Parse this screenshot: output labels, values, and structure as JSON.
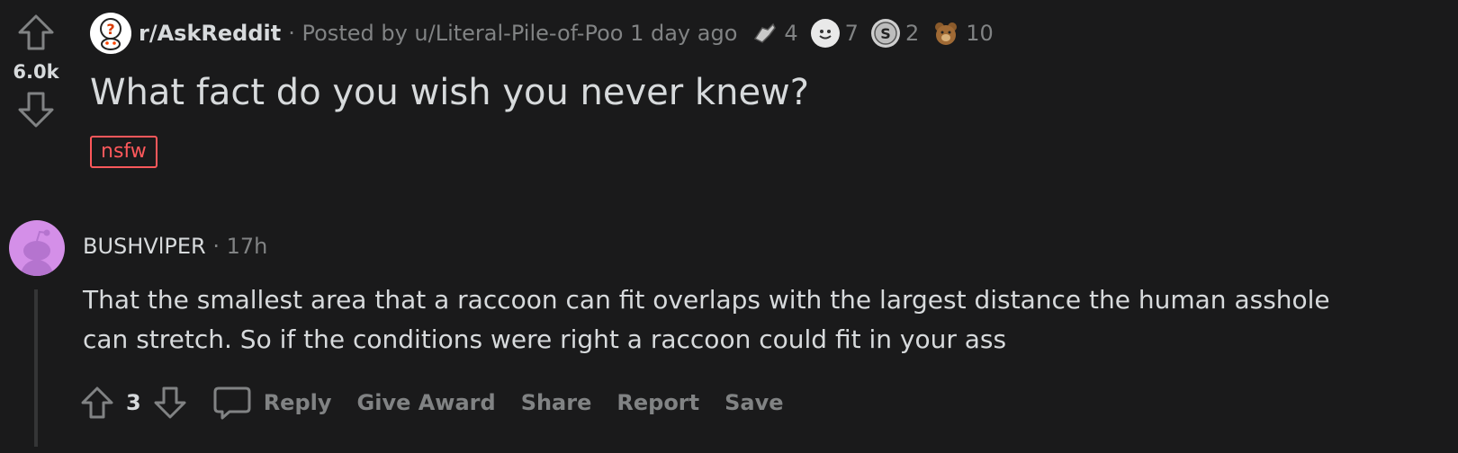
{
  "post": {
    "score": "6.0k",
    "subreddit": "r/AskReddit",
    "meta": "· Posted by u/Literal-Pile-of-Poo 1 day ago",
    "awards": [
      {
        "icon": "helpful-award-icon",
        "count": "4"
      },
      {
        "icon": "wholesome-award-icon",
        "count": "7"
      },
      {
        "icon": "silver-award-icon",
        "count": "2"
      },
      {
        "icon": "bear-award-icon",
        "count": "10"
      }
    ],
    "title": "What fact do you wish you never knew?",
    "flair": "nsfw"
  },
  "comment": {
    "author": "BUSHVlPER",
    "meta": "· 17h",
    "body": "That the smallest area that a raccoon can fit overlaps with the largest distance the human asshole can stretch. So if the conditions were right a raccoon could fit in your ass",
    "score": "3",
    "actions": {
      "reply": "Reply",
      "give_award": "Give Award",
      "share": "Share",
      "report": "Report",
      "save": "Save"
    }
  },
  "colors": {
    "background": "#1a1a1b",
    "text": "#d7dadc",
    "muted": "#818384",
    "nsfw": "#ff585b",
    "avatar": "#d48fe8"
  }
}
